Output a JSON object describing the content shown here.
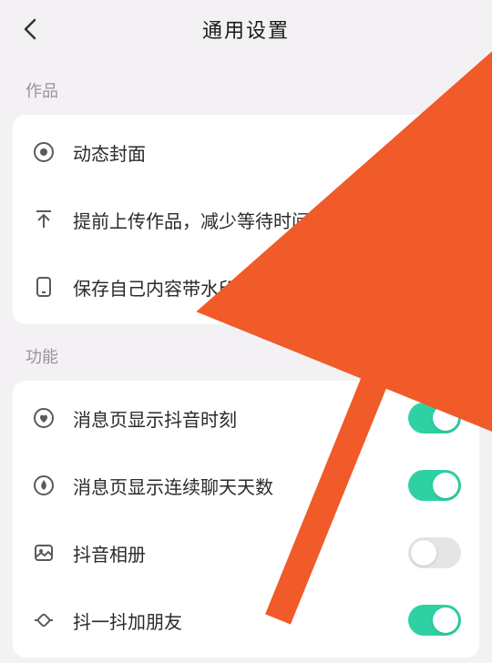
{
  "header": {
    "title": "通用设置"
  },
  "sections": [
    {
      "label": "作品",
      "items": [
        {
          "label": "动态封面",
          "toggle": true
        },
        {
          "label": "提前上传作品，减少等待时间",
          "toggle": true
        },
        {
          "label": "保存自己内容带水印",
          "toggle": true
        }
      ]
    },
    {
      "label": "功能",
      "items": [
        {
          "label": "消息页显示抖音时刻",
          "toggle": true
        },
        {
          "label": "消息页显示连续聊天天数",
          "toggle": true
        },
        {
          "label": "抖音相册",
          "toggle": false
        },
        {
          "label": "抖一抖加朋友",
          "toggle": true
        }
      ]
    }
  ],
  "colors": {
    "toggle_on": "#2fd1a4",
    "arrow": "#f15a29"
  }
}
